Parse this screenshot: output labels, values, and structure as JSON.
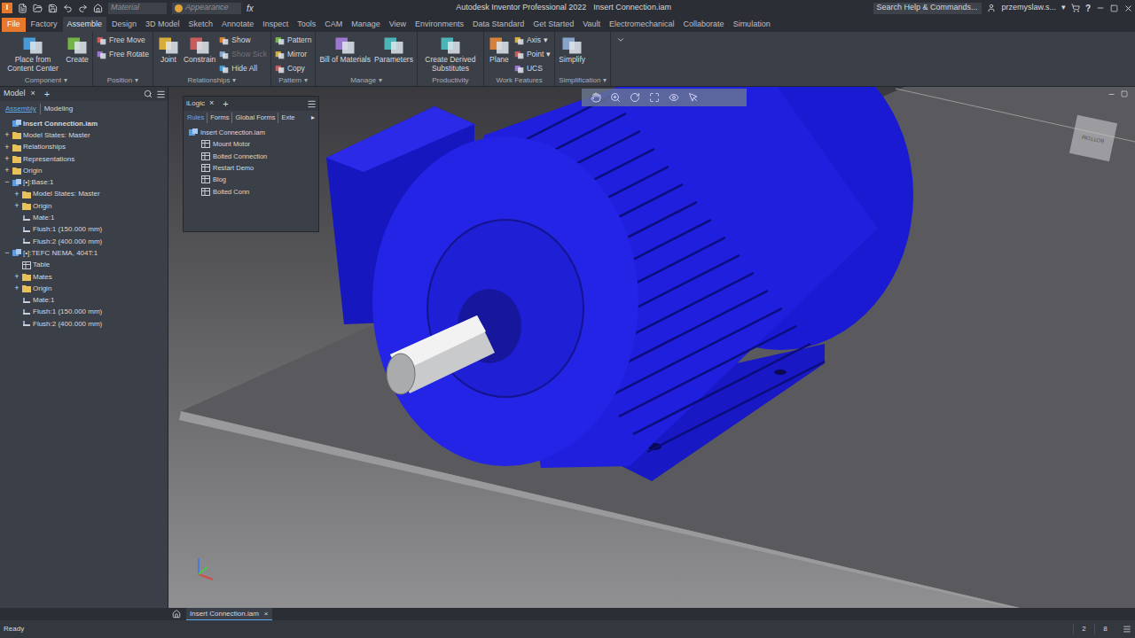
{
  "title_bar": {
    "logo": "I",
    "material": "Material",
    "appearance": "Appearance",
    "fx": "fx",
    "app_title": "Autodesk Inventor Professional 2022",
    "doc_title": "Insert Connection.iam",
    "search_placeholder": "Search Help & Commands...",
    "user": "przemyslaw.s...",
    "user_arrow": "▾",
    "help": "?"
  },
  "menu_tabs": [
    {
      "label": "File",
      "selected": false,
      "kind": "file"
    },
    {
      "label": "Factory",
      "selected": false,
      "kind": "tab"
    },
    {
      "label": "Assemble",
      "selected": true,
      "kind": "tab"
    },
    {
      "label": "Design",
      "selected": false,
      "kind": "tab"
    },
    {
      "label": "3D Model",
      "selected": false,
      "kind": "tab"
    },
    {
      "label": "Sketch",
      "selected": false,
      "kind": "tab"
    },
    {
      "label": "Annotate",
      "selected": false,
      "kind": "tab"
    },
    {
      "label": "Inspect",
      "selected": false,
      "kind": "tab"
    },
    {
      "label": "Tools",
      "selected": false,
      "kind": "tab"
    },
    {
      "label": "CAM",
      "selected": false,
      "kind": "tab"
    },
    {
      "label": "Manage",
      "selected": false,
      "kind": "tab"
    },
    {
      "label": "View",
      "selected": false,
      "kind": "tab"
    },
    {
      "label": "Environments",
      "selected": false,
      "kind": "tab"
    },
    {
      "label": "Data Standard",
      "selected": false,
      "kind": "tab"
    },
    {
      "label": "Get Started",
      "selected": false,
      "kind": "tab"
    },
    {
      "label": "Vault",
      "selected": false,
      "kind": "tab"
    },
    {
      "label": "Electromechanical",
      "selected": false,
      "kind": "tab"
    },
    {
      "label": "Collaborate",
      "selected": false,
      "kind": "tab"
    },
    {
      "label": "Simulation",
      "selected": false,
      "kind": "tab"
    }
  ],
  "ribbon_groups": [
    {
      "label": "Component",
      "arrow": "▾",
      "large": [
        {
          "label": "Place from Content Center"
        },
        {
          "label": "Create"
        }
      ],
      "small": []
    },
    {
      "label": "Position",
      "arrow": "▾",
      "large": [],
      "small": [
        {
          "label": "Free Move",
          "disabled": false,
          "arrow": ""
        },
        {
          "label": "Free Rotate",
          "disabled": false,
          "arrow": ""
        }
      ]
    },
    {
      "label": "Relationships",
      "arrow": "▾",
      "large": [
        {
          "label": "Joint"
        },
        {
          "label": "Constrain"
        }
      ],
      "small": [
        {
          "label": "Show",
          "disabled": false,
          "arrow": ""
        },
        {
          "label": "Show Sick",
          "disabled": true,
          "arrow": ""
        },
        {
          "label": "Hide All",
          "disabled": false,
          "arrow": ""
        }
      ]
    },
    {
      "label": "Pattern",
      "arrow": "▾",
      "large": [],
      "small": [
        {
          "label": "Pattern",
          "disabled": false,
          "arrow": ""
        },
        {
          "label": "Mirror",
          "disabled": false,
          "arrow": ""
        },
        {
          "label": "Copy",
          "disabled": false,
          "arrow": ""
        }
      ]
    },
    {
      "label": "Manage",
      "arrow": "▾",
      "large": [
        {
          "label": "Bill of Materials"
        },
        {
          "label": "Parameters"
        }
      ],
      "small": []
    },
    {
      "label": "Productivity",
      "arrow": "",
      "large": [
        {
          "label": "Create Derived Substitutes"
        }
      ],
      "small": []
    },
    {
      "label": "Work Features",
      "arrow": "",
      "large": [
        {
          "label": "Plane"
        }
      ],
      "small": [
        {
          "label": "Axis",
          "disabled": false,
          "arrow": "▾"
        },
        {
          "label": "Point",
          "disabled": false,
          "arrow": "▾"
        },
        {
          "label": "UCS",
          "disabled": false,
          "arrow": ""
        }
      ]
    },
    {
      "label": "Simplification",
      "arrow": "▾",
      "large": [
        {
          "label": "Simplify"
        }
      ],
      "small": []
    }
  ],
  "model_browser": {
    "tab": "Model",
    "close": "×",
    "add": "+",
    "subtabs": [
      {
        "label": "Assembly",
        "selected": true
      },
      {
        "label": "Modeling",
        "selected": false
      }
    ],
    "items": [
      {
        "label": "Insert Connection.iam",
        "depth": 0,
        "expander": "",
        "kind": "assembly",
        "bold": true
      },
      {
        "label": "Model States: Master",
        "depth": 0,
        "expander": "+",
        "kind": "folder",
        "bold": false
      },
      {
        "label": "Relationships",
        "depth": 0,
        "expander": "+",
        "kind": "folder",
        "bold": false
      },
      {
        "label": "Representations",
        "depth": 0,
        "expander": "+",
        "kind": "folder",
        "bold": false
      },
      {
        "label": "Origin",
        "depth": 0,
        "expander": "+",
        "kind": "folder",
        "bold": false
      },
      {
        "label": "[•]:Base:1",
        "depth": 0,
        "expander": "−",
        "kind": "part",
        "bold": false
      },
      {
        "label": "Model States: Master",
        "depth": 1,
        "expander": "+",
        "kind": "folder",
        "bold": false
      },
      {
        "label": "Origin",
        "depth": 1,
        "expander": "+",
        "kind": "folder",
        "bold": false
      },
      {
        "label": "Mate:1",
        "depth": 1,
        "expander": "",
        "kind": "constraint",
        "bold": false
      },
      {
        "label": "Flush:1 (150.000 mm)",
        "depth": 1,
        "expander": "",
        "kind": "constraint",
        "bold": false
      },
      {
        "label": "Flush:2 (400.000 mm)",
        "depth": 1,
        "expander": "",
        "kind": "constraint",
        "bold": false
      },
      {
        "label": "[•]:TEFC NEMA, 404T:1",
        "depth": 0,
        "expander": "−",
        "kind": "assembly",
        "bold": false
      },
      {
        "label": "Table",
        "depth": 1,
        "expander": "",
        "kind": "table",
        "bold": false
      },
      {
        "label": "Mates",
        "depth": 1,
        "expander": "+",
        "kind": "folder",
        "bold": false
      },
      {
        "label": "Origin",
        "depth": 1,
        "expander": "+",
        "kind": "folder",
        "bold": false
      },
      {
        "label": "Mate:1",
        "depth": 1,
        "expander": "",
        "kind": "constraint",
        "bold": false
      },
      {
        "label": "Flush:1 (150.000 mm)",
        "depth": 1,
        "expander": "",
        "kind": "constraint",
        "bold": false
      },
      {
        "label": "Flush:2 (400.000 mm)",
        "depth": 1,
        "expander": "",
        "kind": "constraint",
        "bold": false
      }
    ]
  },
  "ilogic": {
    "tab": "iLogic",
    "close": "×",
    "add": "+",
    "subtabs": [
      {
        "label": "Rules",
        "selected": true
      },
      {
        "label": "Forms",
        "selected": false
      },
      {
        "label": "Global Forms",
        "selected": false
      },
      {
        "label": "Exte",
        "selected": false
      }
    ],
    "more": "▸",
    "root": "Insert Connection.iam",
    "rules": [
      "Mount Motor",
      "Bolted Connection",
      "Restart Demo",
      "Blog",
      "Bolted Conn"
    ]
  },
  "viewcube": {
    "label": "BOTTOM"
  },
  "document_tabs": [
    {
      "label": "Insert Connection.iam",
      "close": "×",
      "selected": true
    }
  ],
  "status_bar": {
    "message": "Ready",
    "counts": [
      "2",
      "8"
    ]
  }
}
